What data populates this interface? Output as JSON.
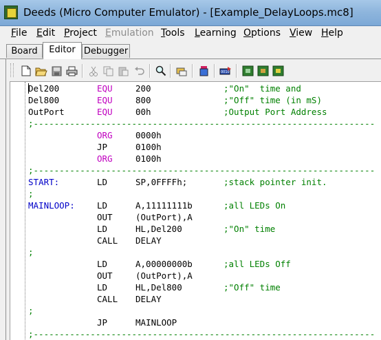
{
  "window": {
    "title": "Deeds (Micro Computer Emulator) - [Example_DelayLoops.mc8]"
  },
  "menu": [
    {
      "label": "File",
      "u": "F",
      "rest": "ile",
      "disabled": false
    },
    {
      "label": "Edit",
      "u": "E",
      "rest": "dit",
      "disabled": false
    },
    {
      "label": "Project",
      "u": "P",
      "rest": "roject",
      "disabled": false
    },
    {
      "label": "Emulation",
      "u": "E",
      "rest": "mulation",
      "disabled": true
    },
    {
      "label": "Tools",
      "u": "T",
      "rest": "ools",
      "disabled": false
    },
    {
      "label": "Learning",
      "u": "L",
      "rest": "earning",
      "disabled": false
    },
    {
      "label": "Options",
      "u": "O",
      "rest": "ptions",
      "disabled": false
    },
    {
      "label": "View",
      "u": "V",
      "rest": "iew",
      "disabled": false
    },
    {
      "label": "Help",
      "u": "H",
      "rest": "elp",
      "disabled": false
    }
  ],
  "tabs": [
    {
      "label": "Board",
      "active": false
    },
    {
      "label": "Editor",
      "active": true
    },
    {
      "label": "Debugger",
      "active": false
    }
  ],
  "toolbar_icons": [
    "new-file-icon",
    "open-folder-icon",
    "save-icon",
    "print-icon",
    "cut-icon",
    "copy-icon",
    "paste-icon",
    "undo-icon",
    "find-icon",
    "compile-icon",
    "memory-icon",
    "assembler-icon",
    "chip-icon-1",
    "chip-icon-2",
    "chip-icon-3"
  ],
  "code": [
    {
      "label": "Del200",
      "op": "EQU",
      "args": "200",
      "comment": ";\"On\"  time and",
      "label_color": "black",
      "op_color": "magenta"
    },
    {
      "label": "Del800",
      "op": "EQU",
      "args": "800",
      "comment": ";\"Off\" time (in mS)",
      "label_color": "black",
      "op_color": "magenta"
    },
    {
      "label": "OutPort",
      "op": "EQU",
      "args": "00h",
      "comment": ";Output Port Address",
      "label_color": "black",
      "op_color": "magenta"
    },
    {
      "full": ";------------------------------------------------------------------"
    },
    {
      "label": "",
      "op": "ORG",
      "args": "0000h",
      "comment": "",
      "op_color": "magenta"
    },
    {
      "label": "",
      "op": "JP",
      "args": "0100h",
      "comment": "",
      "op_color": "black"
    },
    {
      "label": "",
      "op": "ORG",
      "args": "0100h",
      "comment": "",
      "op_color": "magenta"
    },
    {
      "full": ";------------------------------------------------------------------"
    },
    {
      "label": "START:",
      "op": "LD",
      "args": "SP,0FFFFh;",
      "comment": ";stack pointer init.",
      "label_color": "blue",
      "op_color": "black"
    },
    {
      "full": ";"
    },
    {
      "label": "MAINLOOP:",
      "op": "LD",
      "args": "A,11111111b",
      "comment": ";all LEDs On",
      "label_color": "blue",
      "op_color": "black"
    },
    {
      "label": "",
      "op": "OUT",
      "args": "(OutPort),A",
      "comment": "",
      "op_color": "black"
    },
    {
      "label": "",
      "op": "LD",
      "args": "HL,Del200",
      "comment": ";\"On\" time",
      "op_color": "black"
    },
    {
      "label": "",
      "op": "CALL",
      "args": "DELAY",
      "comment": "",
      "op_color": "black"
    },
    {
      "full": ";"
    },
    {
      "label": "",
      "op": "LD",
      "args": "A,00000000b",
      "comment": ";all LEDs Off",
      "op_color": "black"
    },
    {
      "label": "",
      "op": "OUT",
      "args": "(OutPort),A",
      "comment": "",
      "op_color": "black"
    },
    {
      "label": "",
      "op": "LD",
      "args": "HL,Del800",
      "comment": ";\"Off\" time",
      "op_color": "black"
    },
    {
      "label": "",
      "op": "CALL",
      "args": "DELAY",
      "comment": "",
      "op_color": "black"
    },
    {
      "full": ";"
    },
    {
      "label": "",
      "op": "JP",
      "args": "MAINLOOP",
      "comment": "",
      "op_color": "black"
    },
    {
      "full": ";------------------------------------------------------------------"
    }
  ]
}
